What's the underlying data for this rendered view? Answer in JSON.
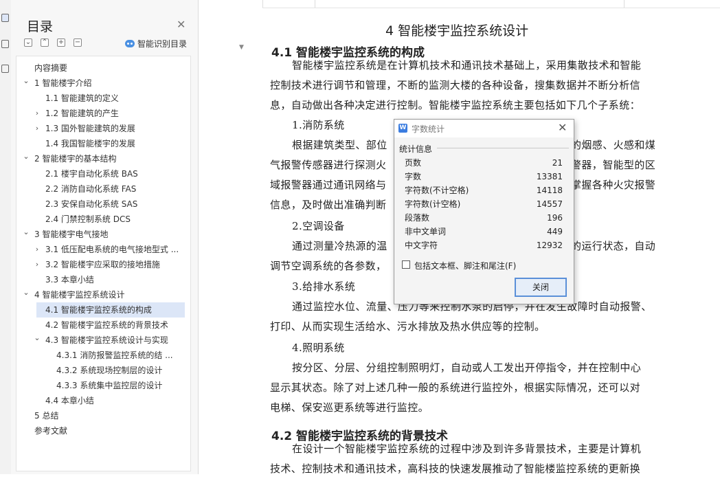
{
  "nav": {
    "title": "目录",
    "smart_toc_label": "智能识别目录",
    "items": [
      {
        "label": "内容摘要",
        "level": 0,
        "chevron": ""
      },
      {
        "label": "1 智能楼宇介绍",
        "level": 0,
        "chevron": "down"
      },
      {
        "label": "1.1 智能建筑的定义",
        "level": 1,
        "chevron": ""
      },
      {
        "label": "1.2 智能建筑的产生",
        "level": 1,
        "chevron": "right"
      },
      {
        "label": "1.3 国外智能建筑的发展",
        "level": 1,
        "chevron": "right"
      },
      {
        "label": "1.4 我国智能楼宇的发展",
        "level": 1,
        "chevron": ""
      },
      {
        "label": "2 智能楼宇的基本结构",
        "level": 0,
        "chevron": "down"
      },
      {
        "label": "2.1 楼宇自动化系统 BAS",
        "level": 1,
        "chevron": ""
      },
      {
        "label": "2.2 消防自动化系统 FAS",
        "level": 1,
        "chevron": ""
      },
      {
        "label": "2.3 安保自动化系统 SAS",
        "level": 1,
        "chevron": ""
      },
      {
        "label": "2.4 门禁控制系统 DCS",
        "level": 1,
        "chevron": ""
      },
      {
        "label": "3 智能楼宇电气接地",
        "level": 0,
        "chevron": "down"
      },
      {
        "label": "3.1 低压配电系统的电气接地型式 ...",
        "level": 1,
        "chevron": "right"
      },
      {
        "label": "3.2 智能楼宇应采取的接地措施",
        "level": 1,
        "chevron": "right"
      },
      {
        "label": "3.3 本章小结",
        "level": 1,
        "chevron": ""
      },
      {
        "label": "4 智能楼宇监控系统设计",
        "level": 0,
        "chevron": "down"
      },
      {
        "label": "4.1 智能楼宇监控系统的构成",
        "level": 1,
        "chevron": "",
        "selected": true
      },
      {
        "label": "4.2 智能楼宇监控系统的背景技术",
        "level": 1,
        "chevron": ""
      },
      {
        "label": "4.3 智能楼宇监控系统设计与实现",
        "level": 1,
        "chevron": "down"
      },
      {
        "label": "4.3.1 消防报警监控系统的结 ...",
        "level": 2,
        "chevron": ""
      },
      {
        "label": "4.3.2 系统现场控制层的设计",
        "level": 2,
        "chevron": ""
      },
      {
        "label": "4.3.3 系统集中监控层的设计",
        "level": 2,
        "chevron": ""
      },
      {
        "label": "4.4 本章小结",
        "level": 1,
        "chevron": ""
      },
      {
        "label": "5 总结",
        "level": 0,
        "chevron": ""
      },
      {
        "label": "参考文献",
        "level": 0,
        "chevron": ""
      }
    ]
  },
  "doc": {
    "chapter_title": "4 智能楼宇监控系统设计",
    "section1_title": "4.1 智能楼宇监控系统的构成",
    "lines": [
      "智能楼宇监控系统是在计算机技术和通讯技术基础上，采用集散技术和智能",
      "控制技术进行调节和管理，不断的监测大楼的各种设备，搜集数据并不断分析信",
      "息，自动做出各种决定进行控制。智能楼宇监控系统主要包括如下几个子系统：",
      "1.消防系统",
      "根据建筑类型、部位",
      "的烟感、火感和煤",
      "气报警传感器进行探测火",
      "警器，智能型的区",
      "域报警器通过通讯网络与",
      "掌握各种火灾报警",
      "信息，及时做出准确判断",
      "2.空调设备",
      "通过测量冷热源的温",
      "的运行状态，自动",
      "调节空调系统的各参数，",
      "3.给排水系统",
      "通过监控水位、流量、压力等来控制水泵的启停，并在发生故障时自动报警、",
      "打印、从而实现生活给水、污水排放及热水供应等的控制。",
      "4.照明系统",
      "按分区、分层、分组控制照明灯，自动或人工发出开停指令，并在控制中心",
      "显示其状态。除了对上述几种一般的系统进行监控外，根据实际情况，还可以对",
      "电梯、保安巡更系统等进行监控。",
      "在设计一个智能楼宇监控系统的过程中涉及到许多背景技术，主要是计算机",
      "技术、控制技术和通讯技术，高科技的快速发展推动了智能楼监控系统的更新换"
    ],
    "section2_title": "4.2 智能楼宇监控系统的背景技术"
  },
  "dialog": {
    "title": "字数统计",
    "icon_text": "W",
    "group_label": "统计信息",
    "stats": [
      {
        "label": "页数",
        "value": "21"
      },
      {
        "label": "字数",
        "value": "13381"
      },
      {
        "label": "字符数(不计空格)",
        "value": "14118"
      },
      {
        "label": "字符数(计空格)",
        "value": "14557"
      },
      {
        "label": "段落数",
        "value": "196"
      },
      {
        "label": "非中文单词",
        "value": "449"
      },
      {
        "label": "中文字符",
        "value": "12932"
      }
    ],
    "checkbox_label": "包括文本框、脚注和尾注(F)",
    "checkbox_checked": false,
    "close_button": "关闭"
  },
  "colors": {
    "accent": "#4a90e2",
    "selected_bg": "#dce6f7"
  }
}
